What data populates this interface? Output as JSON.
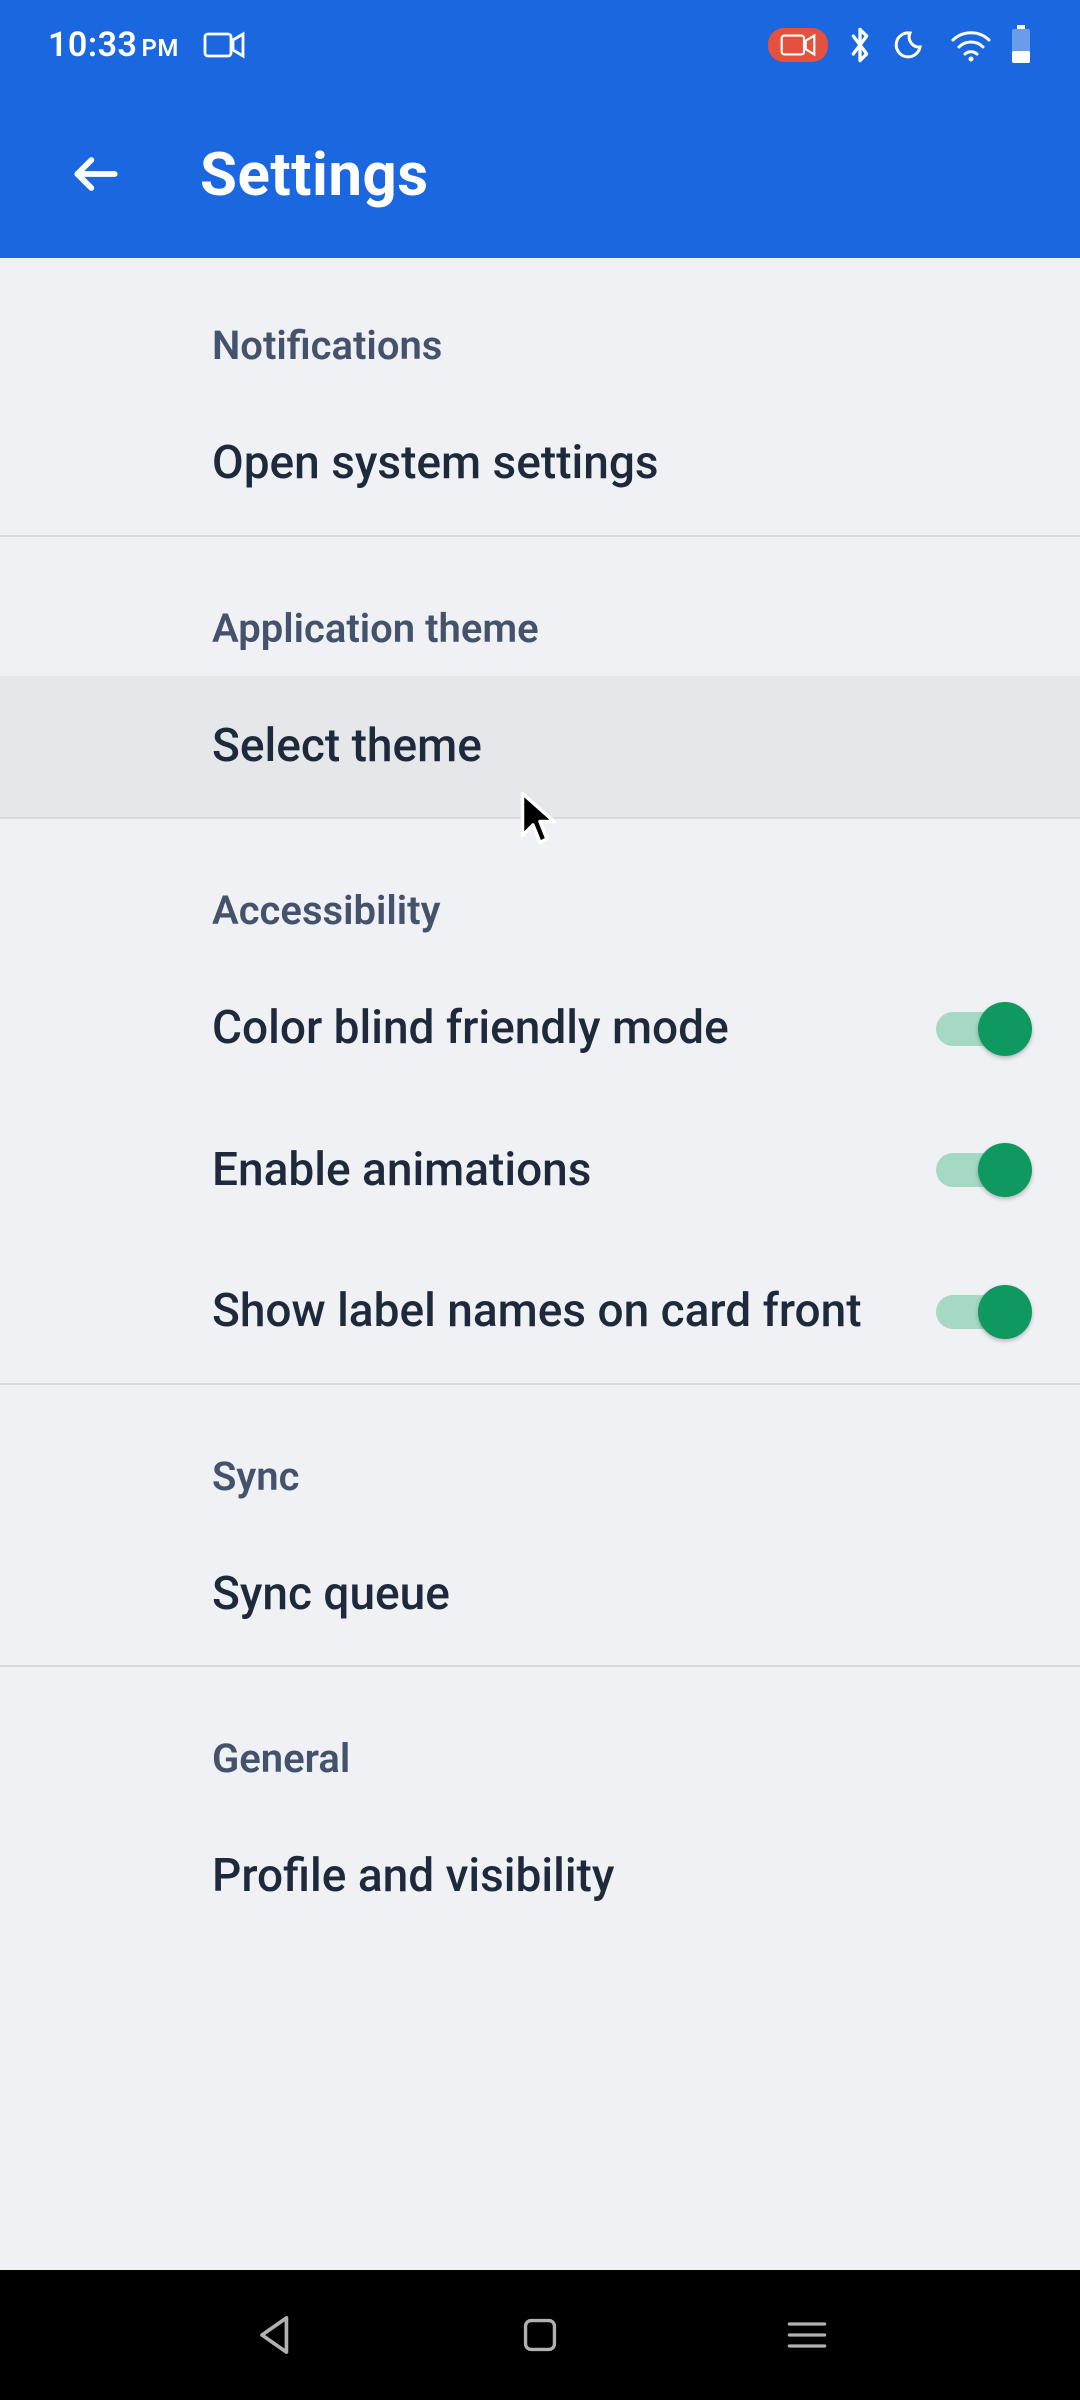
{
  "status": {
    "time": "10:33",
    "ampm": "PM"
  },
  "appbar": {
    "title": "Settings"
  },
  "sections": {
    "notifications": {
      "header": "Notifications",
      "open_system_settings": "Open system settings"
    },
    "theme": {
      "header": "Application theme",
      "select_theme": "Select theme"
    },
    "accessibility": {
      "header": "Accessibility",
      "color_blind": "Color blind friendly mode",
      "enable_animations": "Enable animations",
      "show_label_names": "Show label names on card front"
    },
    "sync": {
      "header": "Sync",
      "sync_queue": "Sync queue"
    },
    "general": {
      "header": "General",
      "profile_visibility": "Profile and visibility"
    }
  },
  "toggles": {
    "color_blind": true,
    "enable_animations": true,
    "show_label_names": true
  },
  "colors": {
    "primary": "#1a67e0",
    "toggle_on": "#0f9960",
    "record_pill": "#e4513c"
  }
}
